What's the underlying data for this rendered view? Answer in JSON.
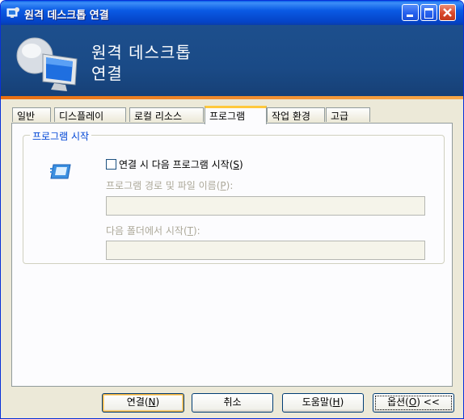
{
  "window": {
    "title": "원격 데스크톱 연결"
  },
  "banner": {
    "line1": "원격 데스크톱",
    "line2": "연결"
  },
  "tabs": [
    {
      "label": "일반"
    },
    {
      "label": "디스플레이"
    },
    {
      "label": "로컬 리소스"
    },
    {
      "label": "프로그램",
      "active": true
    },
    {
      "label": "작업 환경"
    },
    {
      "label": "고급"
    }
  ],
  "program_group": {
    "legend": "프로그램 시작",
    "checkbox_label_prefix": "연결 시 다음 프로그램 시작(",
    "checkbox_label_key": "S",
    "checkbox_label_suffix": ")",
    "checkbox_checked": false,
    "path_label_prefix": "프로그램 경로 및 파일 이름(",
    "path_label_key": "P",
    "path_label_suffix": "):",
    "path_value": "",
    "folder_label_prefix": "다음 폴더에서 시작(",
    "folder_label_key": "T",
    "folder_label_suffix": "):",
    "folder_value": ""
  },
  "buttons": {
    "connect_prefix": "연결(",
    "connect_key": "N",
    "connect_suffix": ")",
    "cancel": "취소",
    "help_prefix": "도움말(",
    "help_key": "H",
    "help_suffix": ")",
    "options_prefix": "옵션(",
    "options_key": "O",
    "options_suffix": ") <<"
  },
  "colors": {
    "title_bar": "#0a5ae4",
    "banner": "#1d4f8d",
    "accent_strip": "#e96f12",
    "legend": "#0046d5"
  }
}
